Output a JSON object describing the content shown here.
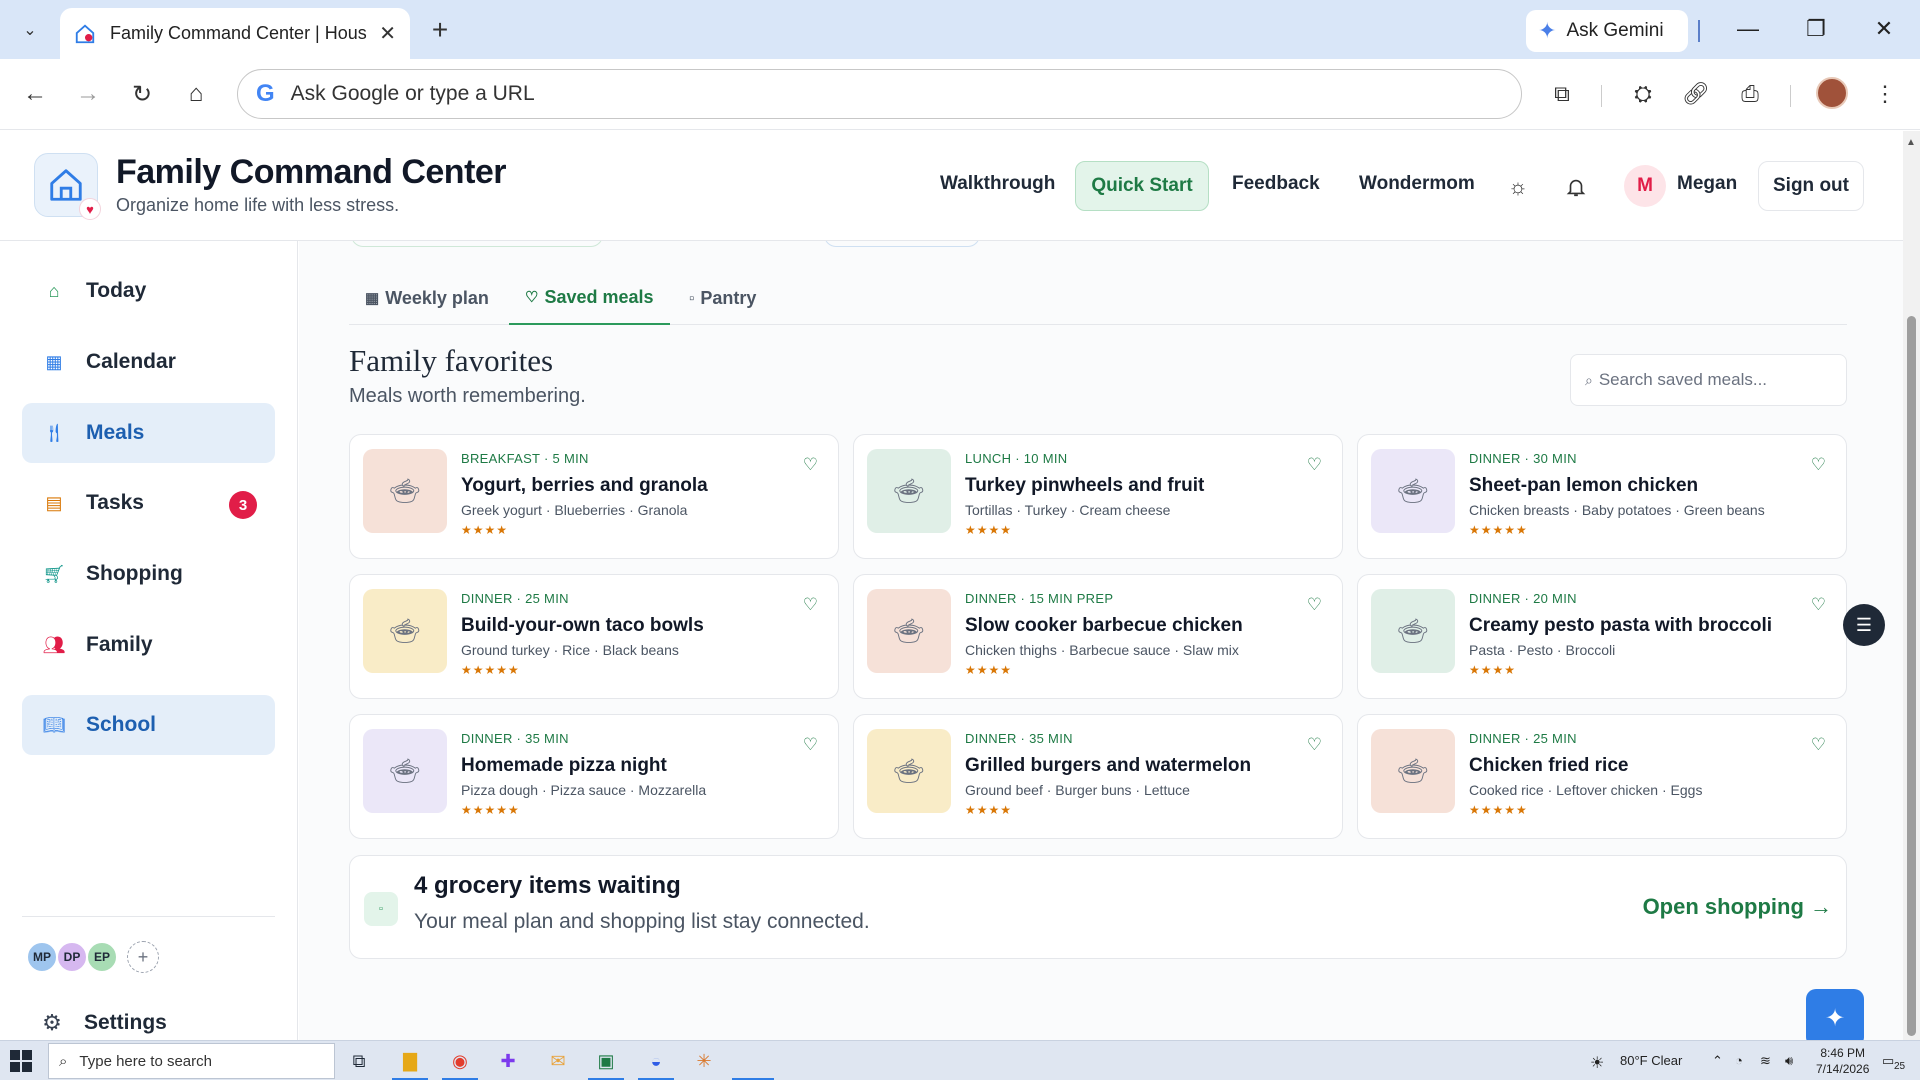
{
  "browser": {
    "tab_title": "Family Command Center | Hous",
    "new_tab_icon": "plus-icon",
    "ask_gemini": "Ask Gemini",
    "omnibox_placeholder": "Ask Google or type a URL"
  },
  "header": {
    "title": "Family Command Center",
    "subtitle": "Organize home life with less stress.",
    "links": {
      "walkthrough": "Walkthrough",
      "quick_start": "Quick Start",
      "feedback": "Feedback",
      "wondermom": "Wondermom"
    },
    "user_initial": "M",
    "user_name": "Megan",
    "sign_out": "Sign out"
  },
  "sidebar": {
    "items": [
      {
        "label": "Today",
        "icon": "home-icon",
        "color": "#2c9a5c"
      },
      {
        "label": "Calendar",
        "icon": "calendar-icon",
        "color": "#2f7de6"
      },
      {
        "label": "Meals",
        "icon": "utensils-icon",
        "color": "#2f7de6"
      },
      {
        "label": "Tasks",
        "icon": "clipboard-icon",
        "color": "#d97706",
        "badge": "3"
      },
      {
        "label": "Shopping",
        "icon": "cart-icon",
        "color": "#0d9488"
      },
      {
        "label": "Family",
        "icon": "people-icon",
        "color": "#e11d48"
      },
      {
        "label": "School",
        "icon": "book-icon",
        "color": "#2f7de6"
      }
    ],
    "avatars": [
      {
        "initials": "MP",
        "color": "#9ec5ee"
      },
      {
        "initials": "DP",
        "color": "#d6b8f0"
      },
      {
        "initials": "EP",
        "color": "#a8dcb4"
      }
    ],
    "add_symbol": "+",
    "settings": "Settings"
  },
  "main": {
    "tabs": [
      {
        "icon": "▦",
        "label": "Weekly plan"
      },
      {
        "icon": "♡",
        "label": "Saved meals"
      },
      {
        "icon": "▫",
        "label": "Pantry"
      }
    ],
    "section_title": "Family favorites",
    "section_subtitle": "Meals worth remembering.",
    "search_placeholder": "Search saved meals...",
    "meals": [
      {
        "meta": "BREAKFAST · 5 MIN",
        "name": "Yogurt, berries and granola",
        "ingredients": "Greek yogurt · Blueberries · Granola",
        "stars": "★★★★",
        "rating": 4,
        "bg": "#f6e1d8"
      },
      {
        "meta": "LUNCH · 10 MIN",
        "name": "Turkey pinwheels and fruit",
        "ingredients": "Tortillas · Turkey · Cream cheese",
        "stars": "★★★★",
        "rating": 4,
        "bg": "#e0efe7"
      },
      {
        "meta": "DINNER · 30 MIN",
        "name": "Sheet-pan lemon chicken",
        "ingredients": "Chicken breasts · Baby potatoes · Green beans",
        "stars": "★★★★★",
        "rating": 5,
        "bg": "#ebe7f8"
      },
      {
        "meta": "DINNER · 25 MIN",
        "name": "Build-your-own taco bowls",
        "ingredients": "Ground turkey · Rice · Black beans",
        "stars": "★★★★★",
        "rating": 5,
        "bg": "#f9ecc7"
      },
      {
        "meta": "DINNER · 15 MIN PREP",
        "name": "Slow cooker barbecue chicken",
        "ingredients": "Chicken thighs · Barbecue sauce · Slaw mix",
        "stars": "★★★★",
        "rating": 4,
        "bg": "#f6e1d8"
      },
      {
        "meta": "DINNER · 20 MIN",
        "name": "Creamy pesto pasta with broccoli",
        "ingredients": "Pasta · Pesto · Broccoli",
        "stars": "★★★★",
        "rating": 4,
        "bg": "#e0efe7"
      },
      {
        "meta": "DINNER · 35 MIN",
        "name": "Homemade pizza night",
        "ingredients": "Pizza dough · Pizza sauce · Mozzarella",
        "stars": "★★★★★",
        "rating": 5,
        "bg": "#ebe7f8"
      },
      {
        "meta": "DINNER · 35 MIN",
        "name": "Grilled burgers and watermelon",
        "ingredients": "Ground beef · Burger buns · Lettuce",
        "stars": "★★★★",
        "rating": 4,
        "bg": "#f9ecc7"
      },
      {
        "meta": "DINNER · 25 MIN",
        "name": "Chicken fried rice",
        "ingredients": "Cooked rice · Leftover chicken · Eggs",
        "stars": "★★★★★",
        "rating": 5,
        "bg": "#f6e1d8"
      }
    ],
    "grocery_title": "4 grocery items waiting",
    "grocery_subtitle": "Your meal plan and shopping list stay connected.",
    "grocery_link": "Open shopping →"
  },
  "taskbar": {
    "search_placeholder": "Type here to search",
    "weather": "80°F  Clear",
    "time": "8:46 PM",
    "date": "7/14/2026",
    "notification_count": "25"
  }
}
